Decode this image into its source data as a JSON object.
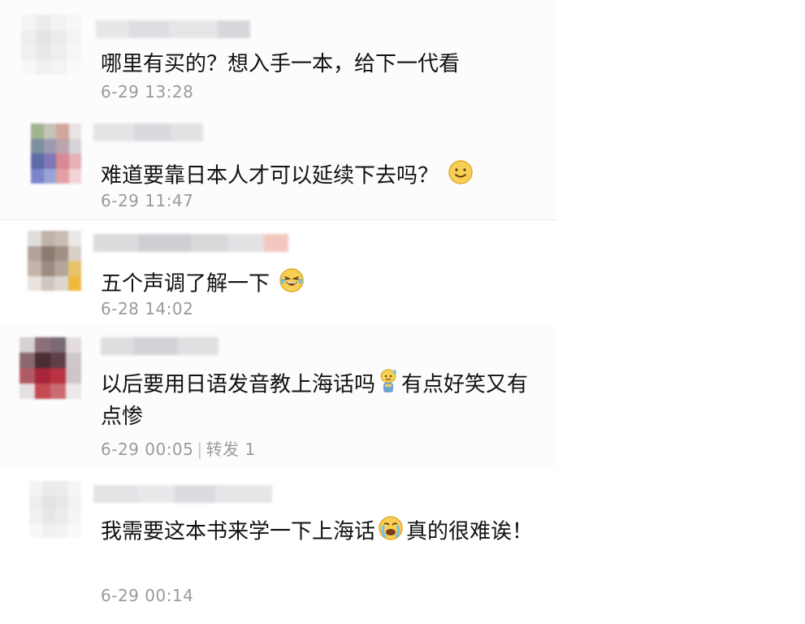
{
  "comments": [
    {
      "text": "哪里有买的？想入手一本，给下一代看",
      "date": "6-29 13:28"
    },
    {
      "text": "难道要靠日本人才可以延续下去吗？",
      "emoji": "smile-emoji",
      "date": "6-29 11:47"
    },
    {
      "text": "五个声调了解一下",
      "emoji": "laughing-tears-emoji",
      "date": "6-28 14:02"
    },
    {
      "text_before": "以后要用日语发音教上海话吗",
      "emoji": "sweat-emoji",
      "text_after": "有点好笑又有点惨",
      "date": "6-29 00:05",
      "separator": "|",
      "repost": "转发 1"
    },
    {
      "text_before": "我需要这本书来学一下上海话",
      "emoji": "crying-laughing-emoji",
      "text_after": "真的很难诶！",
      "date": "6-29 00:14"
    }
  ]
}
